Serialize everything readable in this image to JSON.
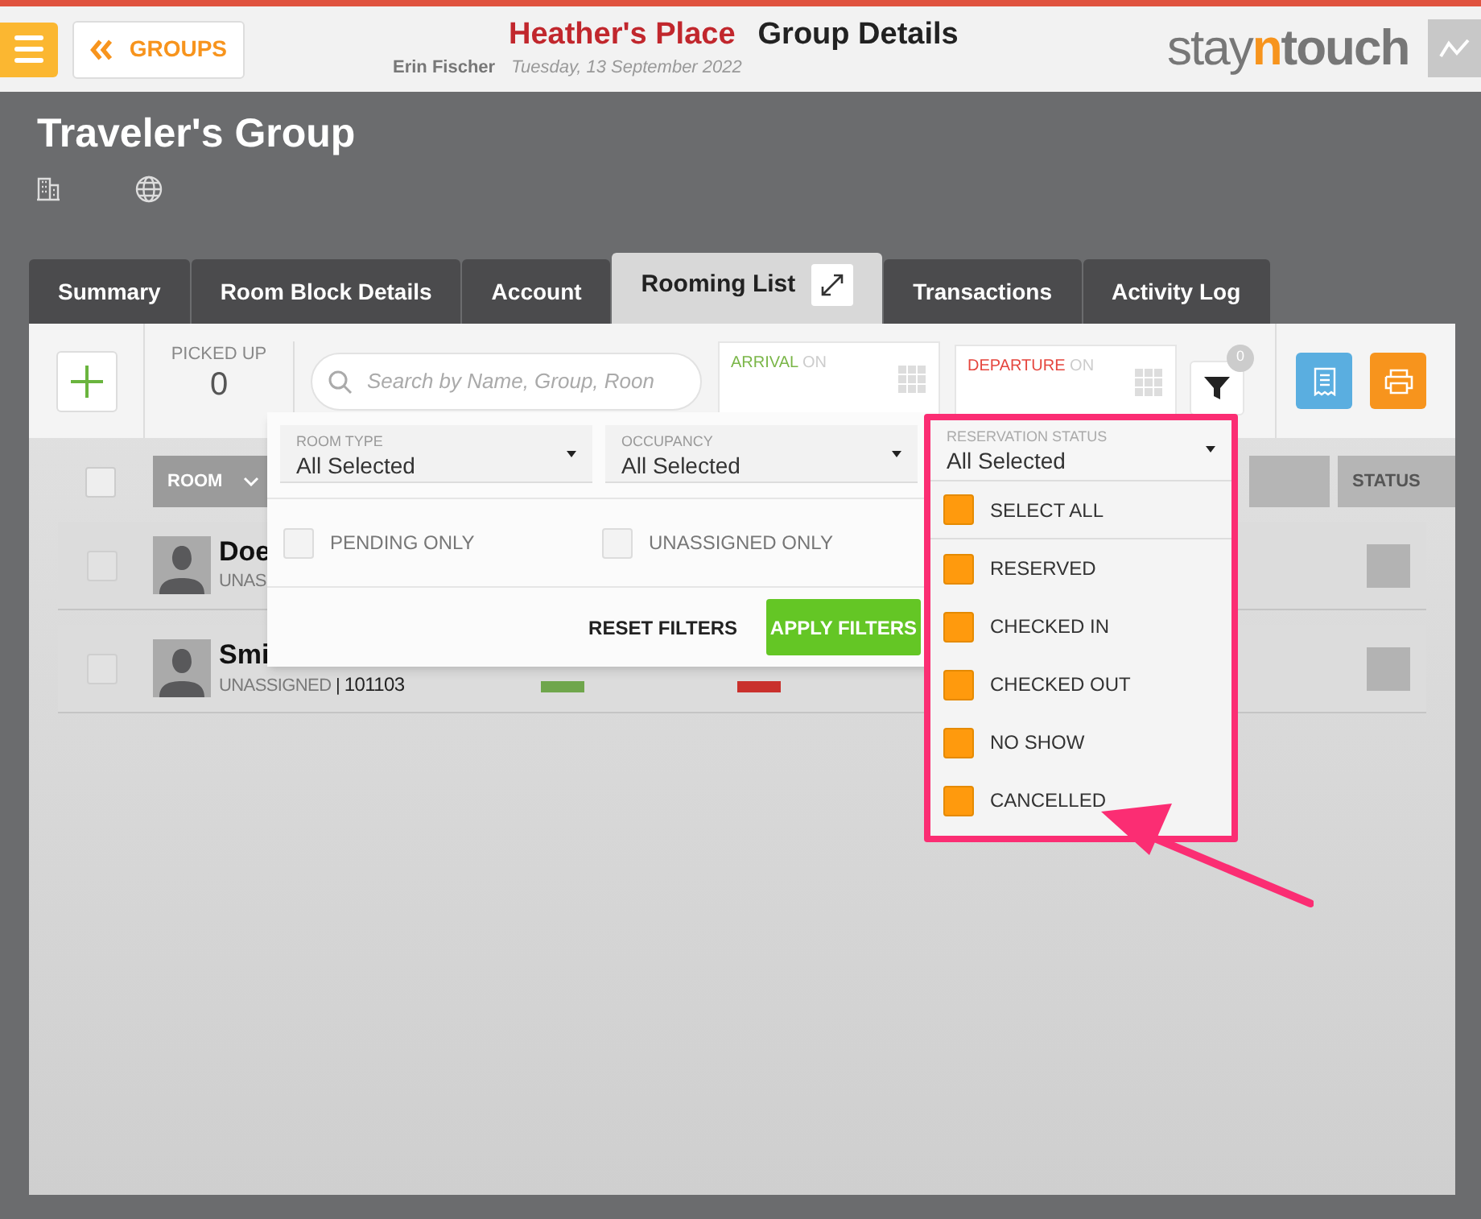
{
  "header": {
    "back_button": "GROUPS",
    "hotel": "Heather's Place",
    "page_title": "Group Details",
    "user": "Erin Fischer",
    "date": "Tuesday, 13 September 2022",
    "logo": [
      "stay",
      "n",
      "touch"
    ]
  },
  "group": {
    "name": "Traveler's Group"
  },
  "tabs": [
    {
      "label": "Summary",
      "selected": false
    },
    {
      "label": "Room Block Details",
      "selected": false
    },
    {
      "label": "Account",
      "selected": false
    },
    {
      "label": "Rooming List",
      "selected": true
    },
    {
      "label": "Transactions",
      "selected": false
    },
    {
      "label": "Activity Log",
      "selected": false
    }
  ],
  "toolbar": {
    "picked_up_label": "PICKED UP",
    "picked_up": "0",
    "search": {
      "placeholder": "Search by Name, Group, Roon"
    },
    "arrival": {
      "label": "ARRIVAL",
      "suffix": "ON"
    },
    "departure": {
      "label": "DEPARTURE",
      "suffix": "ON"
    },
    "filter_count": "0"
  },
  "table": {
    "columns": [
      "ROOM",
      "STATUS"
    ],
    "all_checked": false,
    "rows": [
      {
        "name": "Doe",
        "detail": "UNAS",
        "checked": false
      },
      {
        "name": "Smi",
        "detail": "UNASSIGNED",
        "separator": "|",
        "room": "101103",
        "checked": false
      }
    ]
  },
  "filters": {
    "selects": [
      {
        "label": "ROOM TYPE",
        "value": "All Selected"
      },
      {
        "label": "OCCUPANCY",
        "value": "All Selected"
      }
    ],
    "checkboxes": [
      {
        "label": "PENDING ONLY",
        "checked": false
      },
      {
        "label": "UNASSIGNED ONLY",
        "checked": false
      }
    ],
    "reset": "RESET FILTERS",
    "apply": "APPLY FILTERS"
  },
  "reservation_status": {
    "label": "RESERVATION STATUS",
    "value": "All Selected",
    "options": [
      {
        "label": "SELECT ALL",
        "checked": true
      },
      {
        "label": "RESERVED",
        "checked": true
      },
      {
        "label": "CHECKED IN",
        "checked": true
      },
      {
        "label": "CHECKED OUT",
        "checked": true
      },
      {
        "label": "NO SHOW",
        "checked": true
      },
      {
        "label": "CANCELLED",
        "checked": true
      }
    ]
  }
}
